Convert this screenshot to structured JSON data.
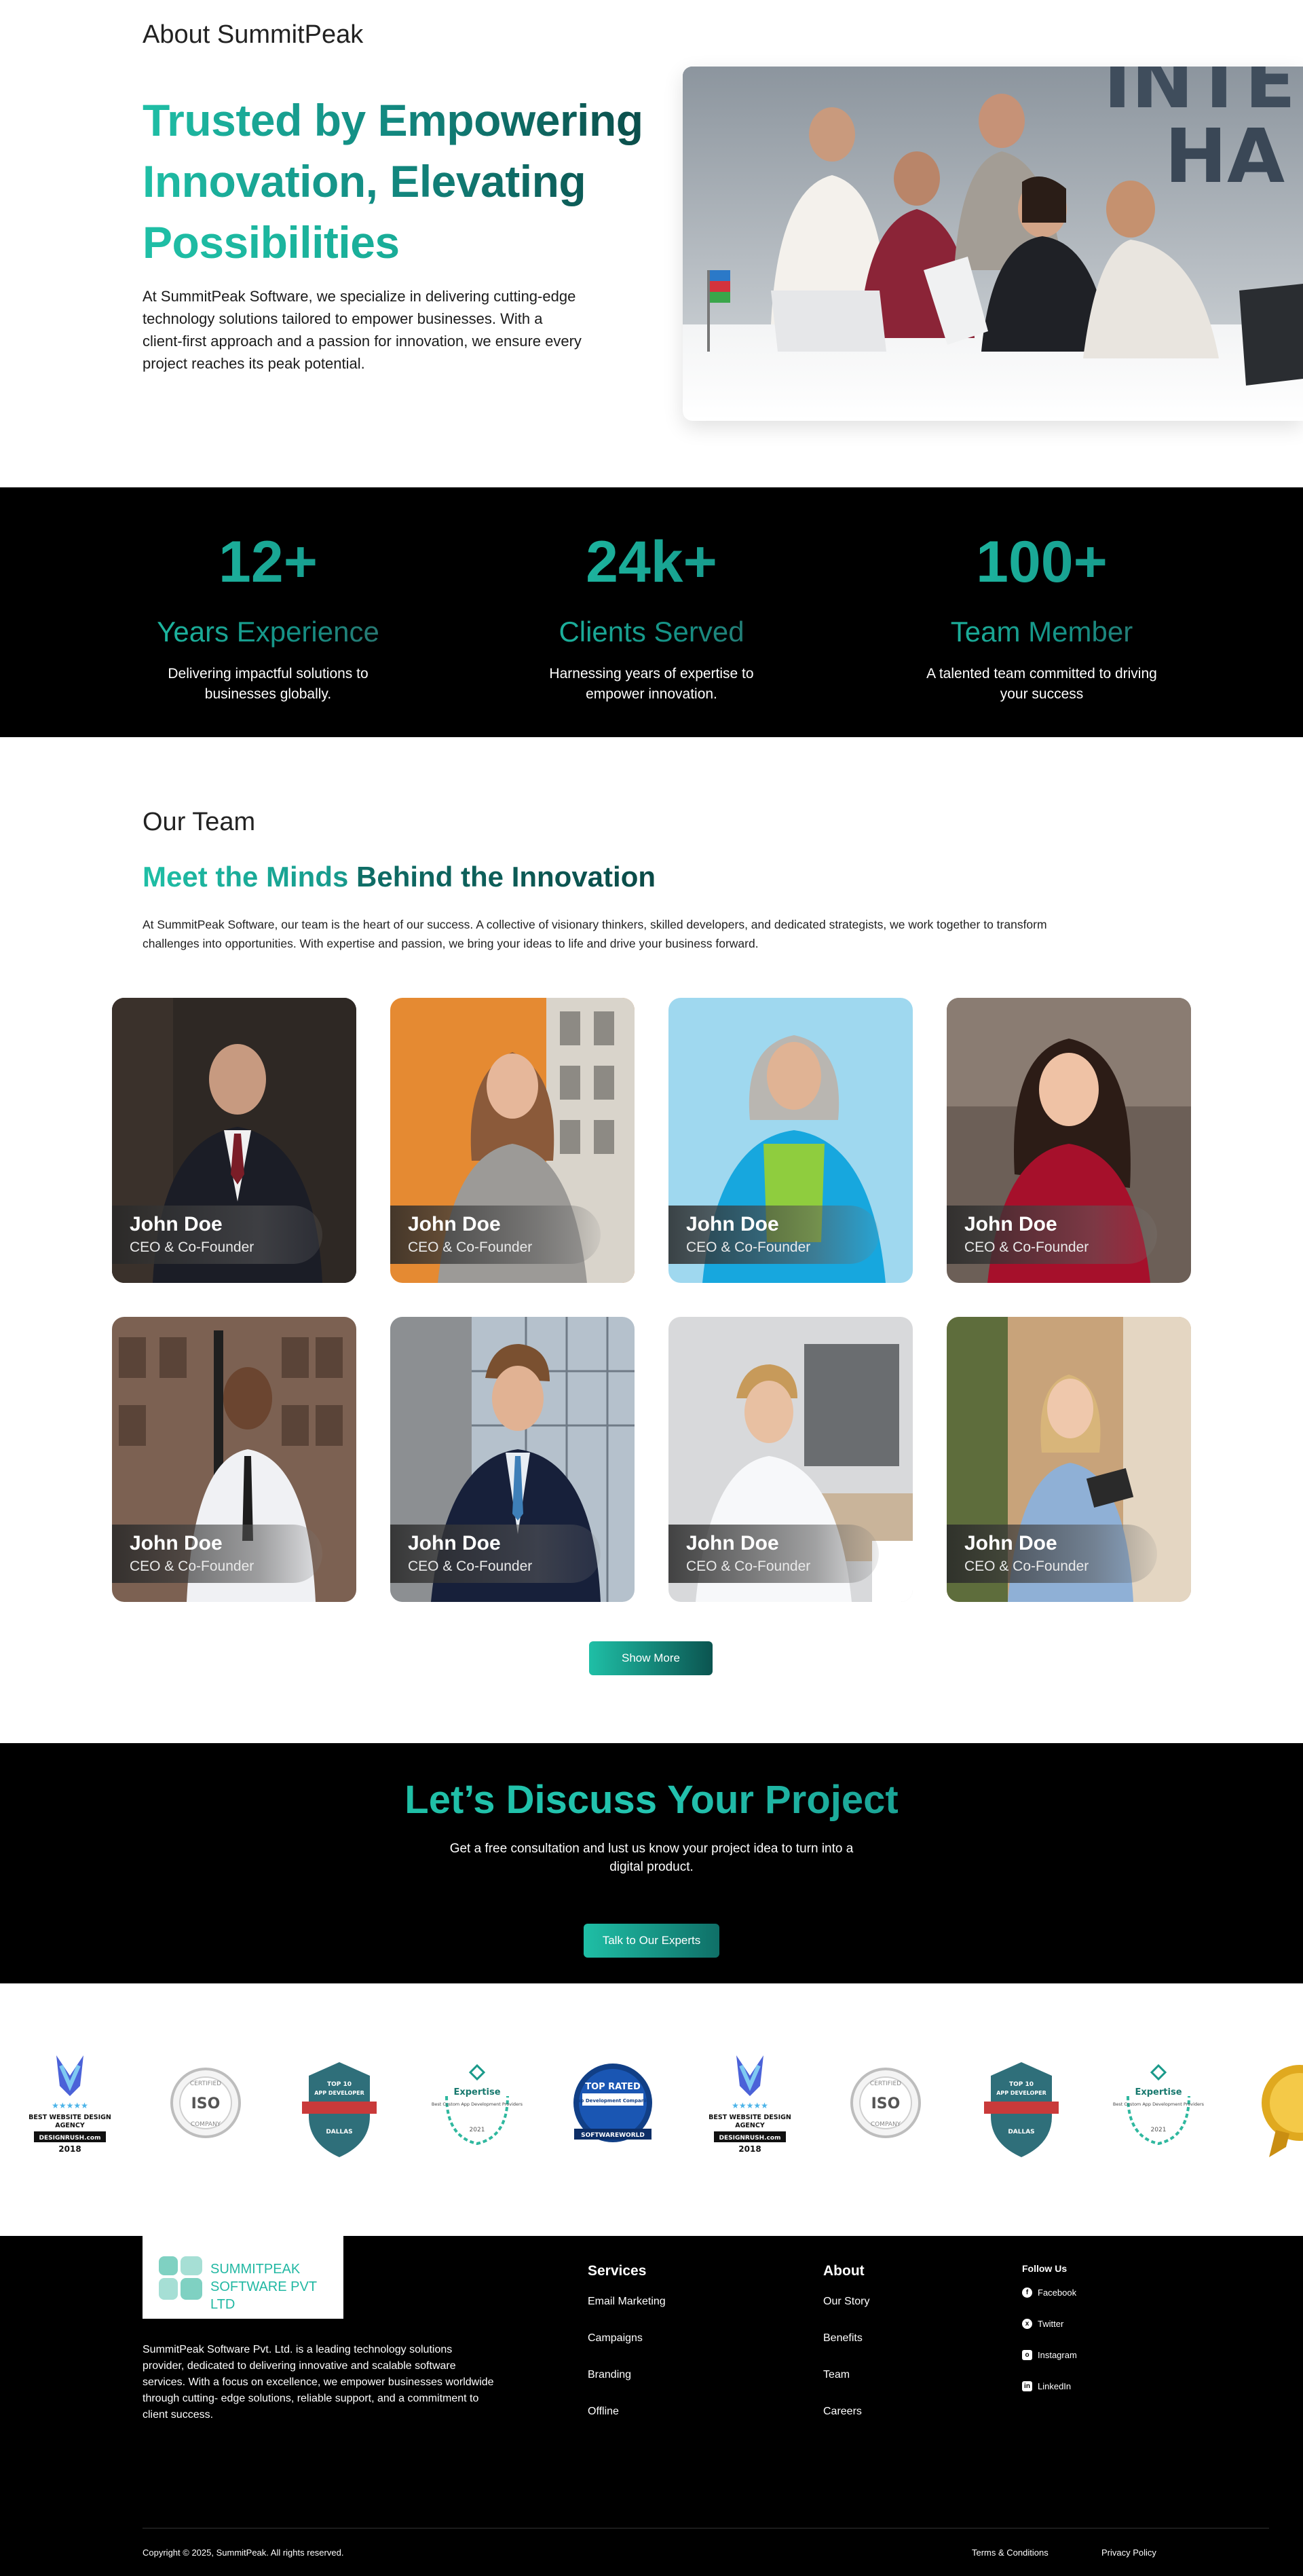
{
  "about": {
    "eyebrow": "About SummitPeak",
    "title_lines": [
      "Trusted by Empowering",
      "Innovation, Elevating",
      "Possibilities"
    ],
    "description": "At SummitPeak Software, we specialize in delivering cutting-edge technology solutions tailored to empower businesses. With a client-first approach and a passion for innovation, we ensure every project reaches its peak potential."
  },
  "stats": [
    {
      "value": "12+",
      "label": "Years Experience",
      "description": "Delivering impactful solutions to businesses globally."
    },
    {
      "value": "24k+",
      "label": "Clients Served",
      "description": "Harnessing years of expertise to empower innovation."
    },
    {
      "value": "100+",
      "label": "Team Member",
      "description": "A talented team committed to driving your success"
    }
  ],
  "team": {
    "eyebrow": "Our Team",
    "heading_accent": "Meet the Minds",
    "heading_rest": " Behind the Innovation",
    "intro": "At SummitPeak Software, our team is the heart of our success. A collective of visionary thinkers, skilled developers, and dedicated strategists, we work together to transform challenges into opportunities. With expertise and passion, we bring your ideas to life and drive your business forward.",
    "members": [
      {
        "name": "John Doe",
        "role": "CEO & Co-Founder"
      },
      {
        "name": "John Doe",
        "role": "CEO & Co-Founder"
      },
      {
        "name": "John Doe",
        "role": "CEO & Co-Founder"
      },
      {
        "name": "John Doe",
        "role": "CEO & Co-Founder"
      },
      {
        "name": "John Doe",
        "role": "CEO & Co-Founder"
      },
      {
        "name": "John Doe",
        "role": "CEO & Co-Founder"
      },
      {
        "name": "John Doe",
        "role": "CEO & Co-Founder"
      },
      {
        "name": "John Doe",
        "role": "CEO & Co-Founder"
      }
    ],
    "show_more_label": "Show More"
  },
  "cta": {
    "title": "Let’s Discuss Your Project",
    "description": "Get a free consultation and lust us know your project idea to turn into a digital product.",
    "button_label": "Talk to Our Experts"
  },
  "badges": {
    "best_agency": {
      "line1": "BEST WEBSITE DESIGN",
      "line2": "AGENCY",
      "brand": "DESIGNRUSH.com",
      "year": "2018"
    },
    "iso": {
      "top": "CERTIFIED",
      "mid": "ISO",
      "bottom": "COMPANY"
    },
    "top_developer": {
      "top": "TOP 10",
      "mid": "APP DEVELOPER",
      "bottom": "DALLAS"
    },
    "expertise": {
      "title": "Expertise",
      "sub": "Best Custom App Development Providers",
      "year": "2021"
    },
    "top_rated": {
      "top": "TOP RATED",
      "mid": "App Development Companies",
      "bottom": "SOFTWAREWORLD"
    }
  },
  "footer": {
    "logo_line1": "SUMMITPEAK",
    "logo_line2": "SOFTWARE PVT LTD",
    "about_text": "SummitPeak Software Pvt. Ltd. is a leading technology solutions provider, dedicated to delivering innovative and scalable software services. With a focus on excellence, we empower businesses worldwide through cutting- edge solutions, reliable support, and a commitment to client success.",
    "services_title": "Services",
    "services": [
      "Email Marketing",
      "Campaigns",
      "Branding",
      "Offline"
    ],
    "about_title": "About",
    "about_links": [
      "Our Story",
      "Benefits",
      "Team",
      "Careers"
    ],
    "follow_title": "Follow Us",
    "social": [
      "Facebook",
      "Twitter",
      "Instagram",
      "LinkedIn"
    ],
    "copyright": "Copyright © 2025, SummitPeak. All rights reserved.",
    "terms": "Terms & Conditions",
    "privacy": "Privacy Policy"
  },
  "colors": {
    "accent": "#1fbfa6",
    "accent_dark": "#0a4a47",
    "dark_bg": "#000000"
  }
}
